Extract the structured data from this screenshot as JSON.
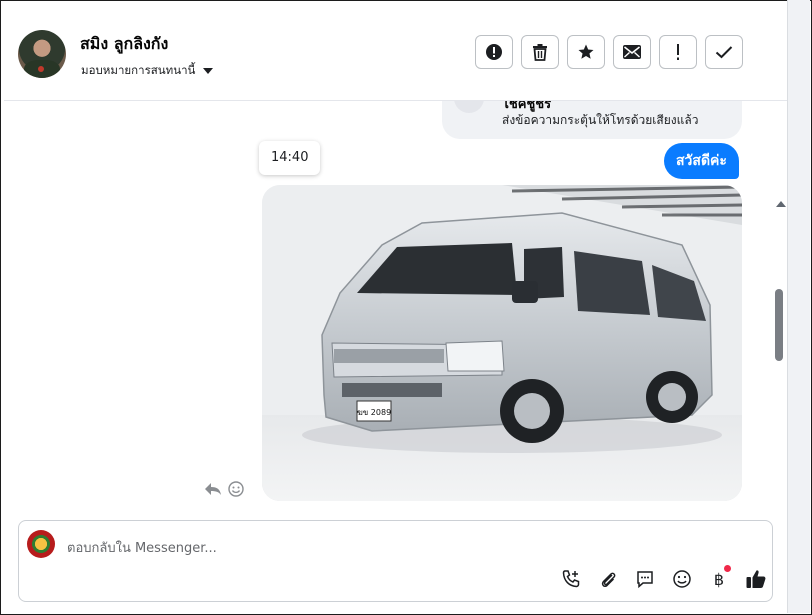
{
  "header": {
    "contact_name": "สมิง ลูกลิงกัง",
    "assign_label": "มอบหมายการสนทนานี้"
  },
  "toolbar": {
    "buttons": [
      {
        "name": "report-spam",
        "icon": "alert-circle-icon"
      },
      {
        "name": "delete",
        "icon": "trash-icon"
      },
      {
        "name": "star",
        "icon": "star-icon"
      },
      {
        "name": "mark-unread",
        "icon": "envelope-icon"
      },
      {
        "name": "follow-up",
        "icon": "exclamation-icon"
      },
      {
        "name": "mark-done",
        "icon": "check-icon"
      }
    ]
  },
  "conversation": {
    "previous_card": {
      "title": "โชคชูชร",
      "subtitle": "ส่งข้อความกระตุ้นให้โทรด้วยเสียงแล้ว"
    },
    "timestamp": "14:40",
    "message_text": "สวัสดีค่ะ",
    "photo": {
      "subject": "silver van",
      "plate_text": "ฆข 2089"
    }
  },
  "composer": {
    "placeholder": "ตอบกลับใน Messenger...",
    "actions": [
      "phone-plus-icon",
      "paperclip-icon",
      "chat-bubble-icon",
      "smiley-icon",
      "baht-icon",
      "thumbs-up-icon"
    ],
    "baht_symbol": "฿"
  },
  "colors": {
    "accent": "#0a7cff",
    "notification": "#f02849"
  }
}
